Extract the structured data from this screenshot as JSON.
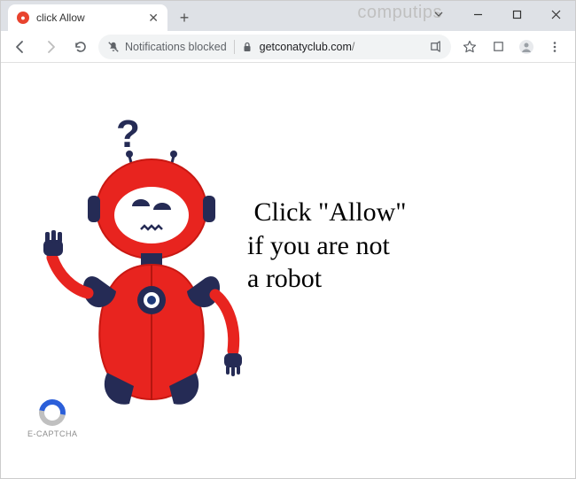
{
  "window": {
    "watermark": "computips"
  },
  "tab": {
    "title": "click Allow"
  },
  "omnibar": {
    "notification_label": "Notifications blocked",
    "url_host": "getconatyclub.com",
    "url_path": "/"
  },
  "page": {
    "line1": "Click \"Allow\"",
    "line2": "if you are not",
    "line3": "a robot",
    "captcha_label": "E-CAPTCHA"
  }
}
